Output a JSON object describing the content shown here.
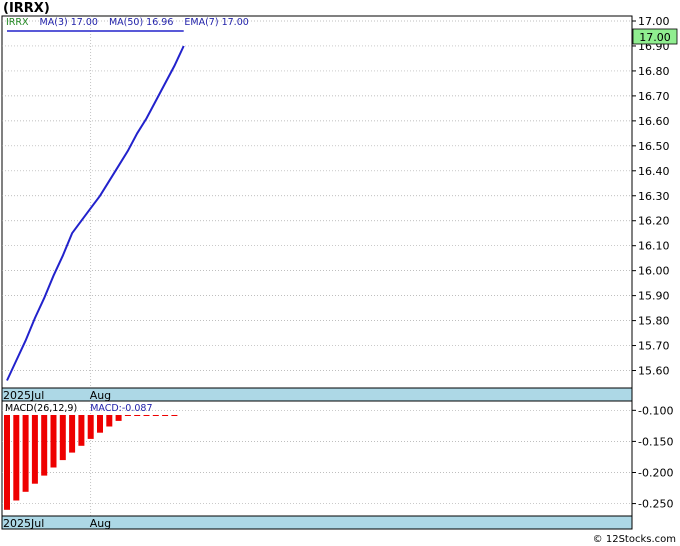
{
  "title": "(IRRX)",
  "copyright": "© 12Stocks.com",
  "colors": {
    "price_line": "#2222cc",
    "legend_ma": "#2222aa",
    "legend_symbol": "#228822",
    "macd_bar": "#ee0000",
    "axis_strip": "#add8e6",
    "last_price_box": "#90ee90",
    "grid": "#aaaaaa"
  },
  "legend": {
    "symbol": "IRRX",
    "ma3": "MA(3)  17.00",
    "ma50": "MA(50)  16.96",
    "ema7": "EMA(7)  17.00"
  },
  "last_price_label": "17.00",
  "macd_legend": {
    "params": "MACD(26,12,9)",
    "value": "MACD:-0.087"
  },
  "chart_data": [
    {
      "type": "line",
      "name": "price",
      "x_tick_labels": [
        "2025Jul",
        "Aug"
      ],
      "x": [
        0,
        1,
        2,
        3,
        4,
        5,
        6,
        7,
        8,
        9,
        10,
        11,
        12,
        13,
        14,
        15,
        16,
        17,
        18,
        19
      ],
      "y": [
        15.56,
        15.64,
        15.72,
        15.81,
        15.89,
        15.98,
        16.06,
        16.15,
        16.2,
        16.25,
        16.3,
        16.36,
        16.42,
        16.48,
        16.55,
        16.61,
        16.68,
        16.75,
        16.82,
        16.9
      ],
      "ma_line": {
        "name": "MA(50)",
        "value": 16.96,
        "flat": true
      },
      "ylim": [
        15.53,
        17.02
      ],
      "y_ticks": [
        15.6,
        15.7,
        15.8,
        15.9,
        16.0,
        16.1,
        16.2,
        16.3,
        16.4,
        16.5,
        16.6,
        16.7,
        16.8,
        16.9,
        17.0
      ],
      "grid": true
    },
    {
      "type": "bar",
      "name": "MACD",
      "x": [
        0,
        1,
        2,
        3,
        4,
        5,
        6,
        7,
        8,
        9,
        10,
        11,
        12,
        13,
        14,
        15,
        16,
        17,
        18
      ],
      "values": [
        -0.26,
        -0.245,
        -0.231,
        -0.218,
        -0.205,
        -0.192,
        -0.18,
        -0.168,
        -0.157,
        -0.146,
        -0.136,
        -0.126,
        -0.117,
        -0.108,
        -0.1,
        -0.093,
        -0.088,
        -0.086,
        -0.083
      ],
      "ylim": [
        -0.27,
        -0.085
      ],
      "y_ticks": [
        -0.1,
        -0.15,
        -0.2,
        -0.25
      ],
      "grid": true
    }
  ]
}
